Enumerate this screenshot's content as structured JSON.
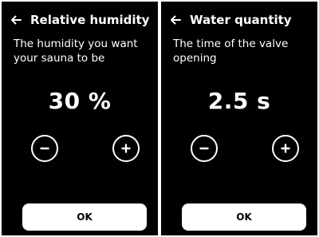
{
  "screens": [
    {
      "title": "Relative humidity",
      "subtitle": "The humidity you want your sauna to be",
      "value": "30 %",
      "ok_label": "OK"
    },
    {
      "title": "Water quantity",
      "subtitle": "The time of the valve opening",
      "value": "2.5 s",
      "ok_label": "OK"
    }
  ],
  "icons": {
    "back": "arrow-left-icon",
    "decrease": "minus-icon",
    "increase": "plus-icon"
  },
  "colors": {
    "screen_background": "#000000",
    "text": "#ffffff",
    "ok_button_background": "#ffffff",
    "ok_button_text": "#000000"
  }
}
